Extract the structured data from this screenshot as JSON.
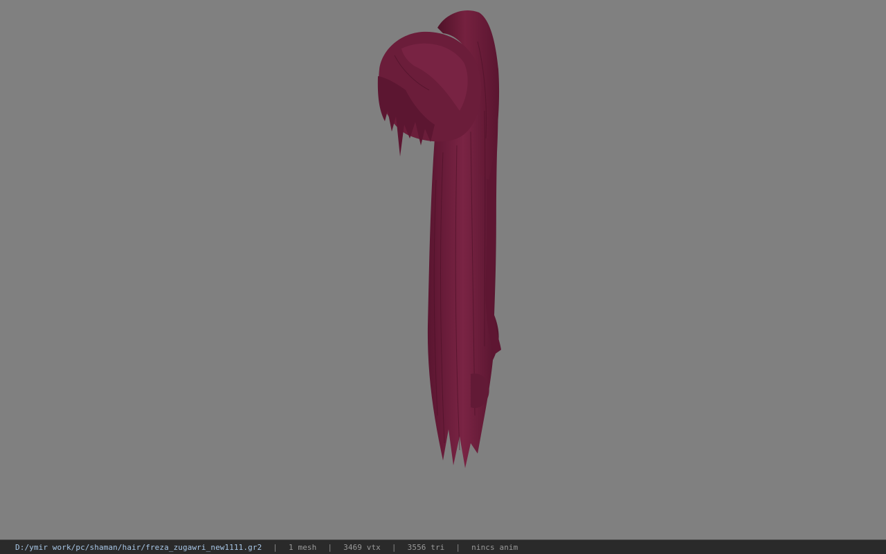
{
  "viewport": {
    "background_color": "#808080",
    "model_color": "#6e1e3c"
  },
  "statusbar": {
    "file_path": "D:/ymir work/pc/shaman/hair/freza_zugawri_new1111.gr2",
    "separator": "|",
    "mesh_count": "1 mesh",
    "vertex_count": "3469 vtx",
    "triangle_count": "3556 tri",
    "anim_status": "nincs anim"
  }
}
